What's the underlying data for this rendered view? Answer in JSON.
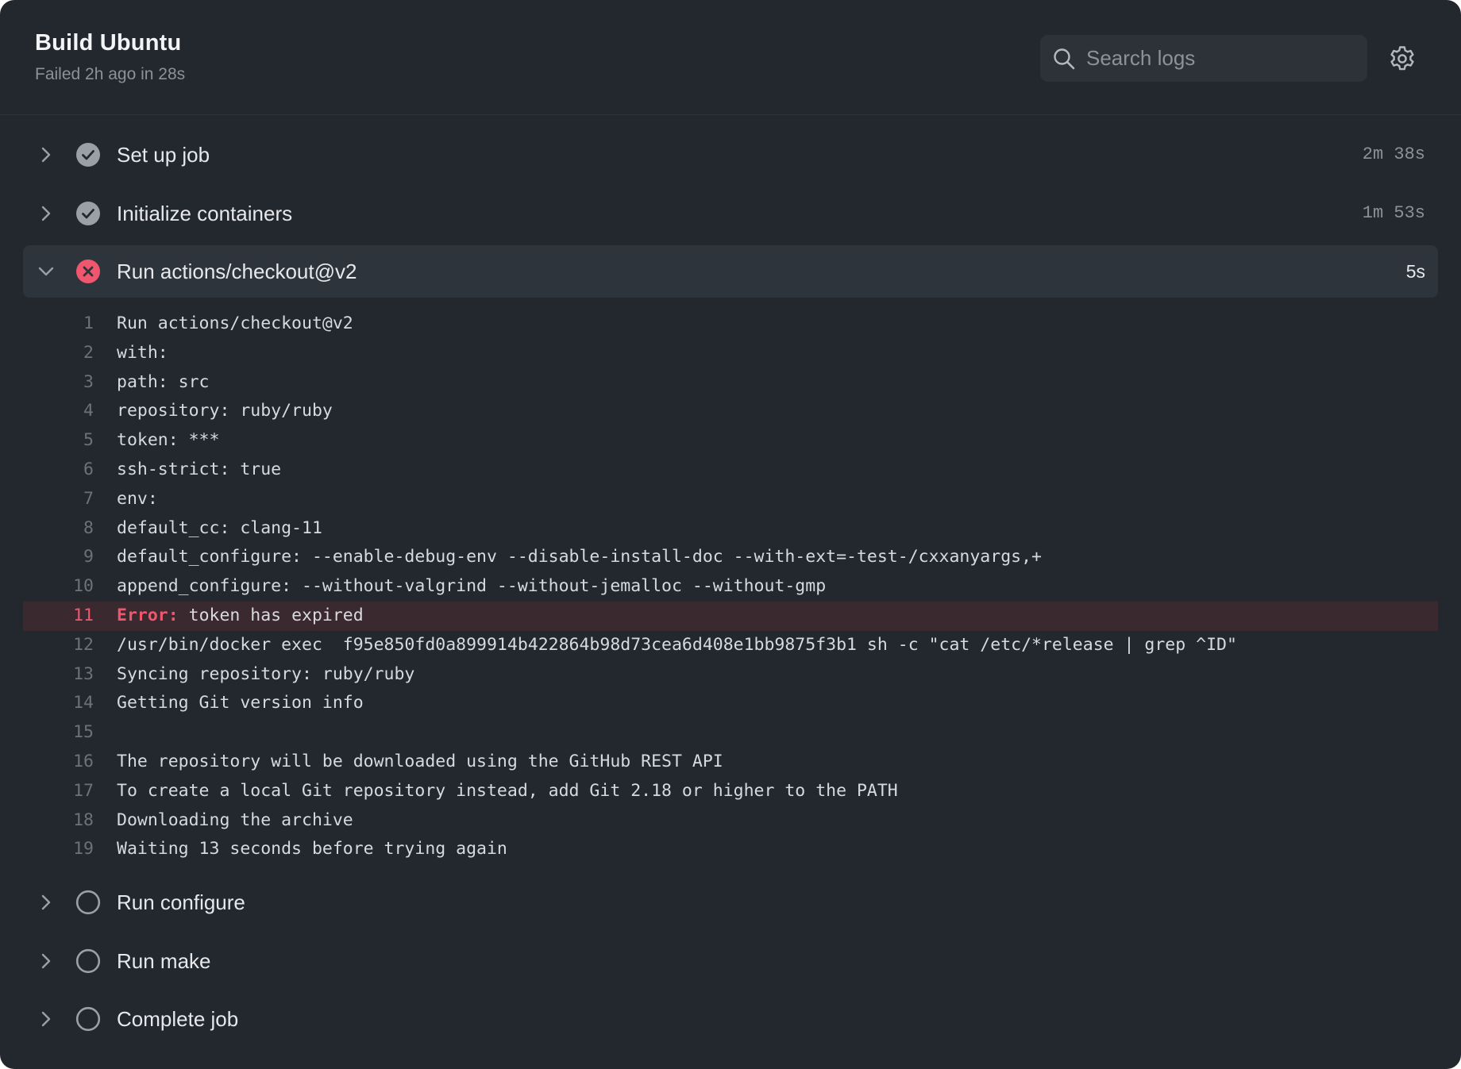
{
  "header": {
    "title": "Build Ubuntu",
    "subtitle": "Failed 2h ago in 28s"
  },
  "search": {
    "placeholder": "Search logs",
    "value": ""
  },
  "icons": {
    "search": "search-icon",
    "settings": "gear-icon",
    "collapsed": "chevron-right-icon",
    "expanded": "chevron-down-icon",
    "success": "check-circle-icon",
    "failure": "x-circle-icon",
    "pending": "empty-circle-icon"
  },
  "colors": {
    "background": "#23272e",
    "expanded_row": "#2e343b",
    "error": "#f0576f",
    "error_row": "#3b2930",
    "success_badge": "#9aa0a8",
    "muted_text": "#8b929b"
  },
  "steps": [
    {
      "label": "Set up job",
      "duration": "2m 38s",
      "status": "success",
      "expanded": false
    },
    {
      "label": "Initialize containers",
      "duration": "1m 53s",
      "status": "success",
      "expanded": false
    },
    {
      "label": "Run actions/checkout@v2",
      "duration": "5s",
      "status": "failure",
      "expanded": true
    },
    {
      "label": "Run configure",
      "duration": "",
      "status": "pending",
      "expanded": false
    },
    {
      "label": "Run make",
      "duration": "",
      "status": "pending",
      "expanded": false
    },
    {
      "label": "Complete job",
      "duration": "",
      "status": "pending",
      "expanded": false
    }
  ],
  "log": {
    "error_prefix": "Error:",
    "lines": [
      {
        "number": "1",
        "text": "Run actions/checkout@v2"
      },
      {
        "number": "2",
        "text": "with:"
      },
      {
        "number": "3",
        "text": "path: src"
      },
      {
        "number": "4",
        "text": "repository: ruby/ruby"
      },
      {
        "number": "5",
        "text": "token: ***"
      },
      {
        "number": "6",
        "text": "ssh-strict: true"
      },
      {
        "number": "7",
        "text": "env:"
      },
      {
        "number": "8",
        "text": "default_cc: clang-11"
      },
      {
        "number": "9",
        "text": "default_configure: --enable-debug-env --disable-install-doc --with-ext=-test-/cxxanyargs,+"
      },
      {
        "number": "10",
        "text": "append_configure: --without-valgrind --without-jemalloc --without-gmp"
      },
      {
        "number": "11",
        "text": "token has expired",
        "error": true
      },
      {
        "number": "12",
        "text": "/usr/bin/docker exec  f95e850fd0a899914b422864b98d73cea6d408e1bb9875f3b1 sh -c \"cat /etc/*release | grep ^ID\""
      },
      {
        "number": "13",
        "text": "Syncing repository: ruby/ruby"
      },
      {
        "number": "14",
        "text": "Getting Git version info"
      },
      {
        "number": "15",
        "text": ""
      },
      {
        "number": "16",
        "text": "The repository will be downloaded using the GitHub REST API"
      },
      {
        "number": "17",
        "text": "To create a local Git repository instead, add Git 2.18 or higher to the PATH"
      },
      {
        "number": "18",
        "text": "Downloading the archive"
      },
      {
        "number": "19",
        "text": "Waiting 13 seconds before trying again"
      }
    ]
  }
}
